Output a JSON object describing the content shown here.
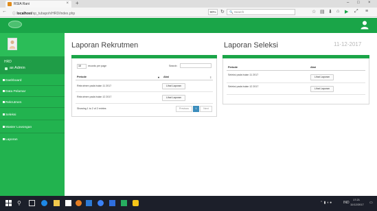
{
  "browser": {
    "tab_title": "RSIA Rani",
    "url_host": "localhost",
    "url_path": "/sp_tubapoh/HRD/index.php",
    "zoom": "90%",
    "search_placeholder": "Search"
  },
  "sidebar": {
    "user_name": "HRD",
    "user_role": "as Admin",
    "items": [
      {
        "label": "Dashboard"
      },
      {
        "label": "Data Pelamar"
      },
      {
        "label": "Rekrutmen"
      },
      {
        "label": "Seleksi"
      },
      {
        "label": "Master Lowongan"
      },
      {
        "label": "Laporan"
      }
    ]
  },
  "main": {
    "title_left": "Laporan Rekrutmen",
    "title_right": "Laporan Seleksi",
    "date": "11-12-2017"
  },
  "rekrutmen": {
    "page_size": "10",
    "records_per_page_label": "records per page",
    "search_label": "Search:",
    "columns": [
      "Periode",
      "Aksi"
    ],
    "rows": [
      {
        "periode": "Rekrutmen pada bulan 11 2017",
        "action": "Lihat Laporan"
      },
      {
        "periode": "Rekrutmen pada bulan 12 2017",
        "action": "Lihat Laporan"
      }
    ],
    "info": "Showing 1 to 2 of 2 entries",
    "pagination": {
      "prev": "Previous",
      "current": "1",
      "next": "Next"
    }
  },
  "seleksi": {
    "columns": [
      "Periode",
      "Aksi"
    ],
    "rows": [
      {
        "periode": "Seleksi pada bulan 11 2017",
        "action": "Lihat Laporan"
      },
      {
        "periode": "Seleksi pada bulan 12 2017",
        "action": "Lihat Laporan"
      }
    ]
  },
  "taskbar": {
    "time": "17:21",
    "date": "11/12/2017",
    "lang": "IND"
  },
  "colors": {
    "brand_green": "#1aa548",
    "sidebar_green": "#22b34f",
    "pager_blue": "#3c8dbc"
  }
}
